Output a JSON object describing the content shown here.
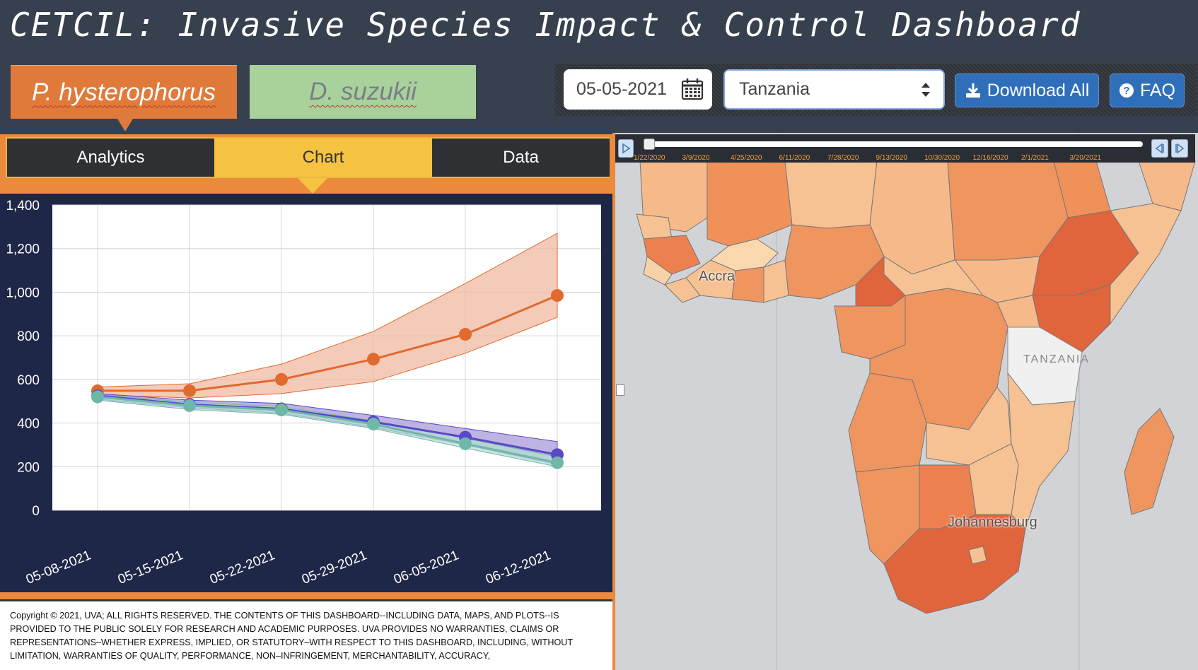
{
  "header": {
    "title": "CETCIL: Invasive Species Impact & Control Dashboard"
  },
  "species": [
    {
      "label": "P. hysterophorus",
      "active": true
    },
    {
      "label": "D. suzukii",
      "active": false
    }
  ],
  "controls": {
    "date": "05-05-2021",
    "country": "Tanzania",
    "download_label": "Download All",
    "faq_label": "FAQ"
  },
  "tabs": [
    {
      "label": "Analytics",
      "active": false
    },
    {
      "label": "Chart",
      "active": true
    },
    {
      "label": "Data",
      "active": false
    }
  ],
  "chart_data": {
    "type": "line",
    "categories": [
      "05-08-2021",
      "05-15-2021",
      "05-22-2021",
      "05-29-2021",
      "06-05-2021",
      "06-12-2021"
    ],
    "ylim": [
      0,
      1400
    ],
    "yticks": [
      0,
      200,
      400,
      600,
      800,
      1000,
      1200,
      1400
    ],
    "ytick_labels": [
      "0",
      "200",
      "400",
      "600",
      "800",
      "1,000",
      "1,200",
      "1,400"
    ],
    "grid": true,
    "series": [
      {
        "color": "#e06a2f",
        "band_color": "#f0b9a0",
        "values": [
          548,
          548,
          600,
          693,
          807,
          985
        ],
        "lower": [
          530,
          515,
          535,
          590,
          720,
          885
        ],
        "upper": [
          565,
          580,
          670,
          820,
          1040,
          1270
        ]
      },
      {
        "color": "#5a48c8",
        "band_color": "#a89ad8",
        "values": [
          525,
          485,
          465,
          405,
          335,
          255
        ],
        "lower": [
          510,
          470,
          445,
          380,
          300,
          210
        ],
        "upper": [
          535,
          505,
          490,
          435,
          375,
          315
        ]
      },
      {
        "color": "#6fb8a8",
        "band_color": "#b6dcd4",
        "values": [
          520,
          480,
          460,
          395,
          305,
          218
        ],
        "lower": [
          505,
          462,
          440,
          375,
          285,
          200
        ],
        "upper": [
          530,
          495,
          475,
          410,
          330,
          245
        ]
      }
    ]
  },
  "timeline": {
    "dates": [
      "1/22/2020",
      "3/9/2020",
      "4/25/2020",
      "6/11/2020",
      "7/28/2020",
      "9/13/2020",
      "10/30/2020",
      "12/16/2020",
      "2/1/2021",
      "3/20/2021"
    ]
  },
  "map": {
    "labels": {
      "accra": "Accra",
      "johannesburg": "Johannesburg",
      "tanzania": "TANZANIA"
    }
  },
  "footer": {
    "copyright": "Copyright © 2021, UVA; ALL RIGHTS RESERVED. THE CONTENTS OF THIS DASHBOARD--INCLUDING DATA, MAPS, AND PLOTS--IS PROVIDED TO THE PUBLIC SOLELY FOR RESEARCH AND ACADEMIC PURPOSES. UVA PROVIDES NO WARRANTIES, CLAIMS OR REPRESENTATIONS–WHETHER EXPRESS, IMPLIED, OR STATUTORY–WITH RESPECT TO THIS DASHBOARD, INCLUDING, WITHOUT LIMITATION, WARRANTIES OF QUALITY, PERFORMANCE, NON–INFRINGEMENT, MERCHANTABILITY, ACCURACY,"
  }
}
